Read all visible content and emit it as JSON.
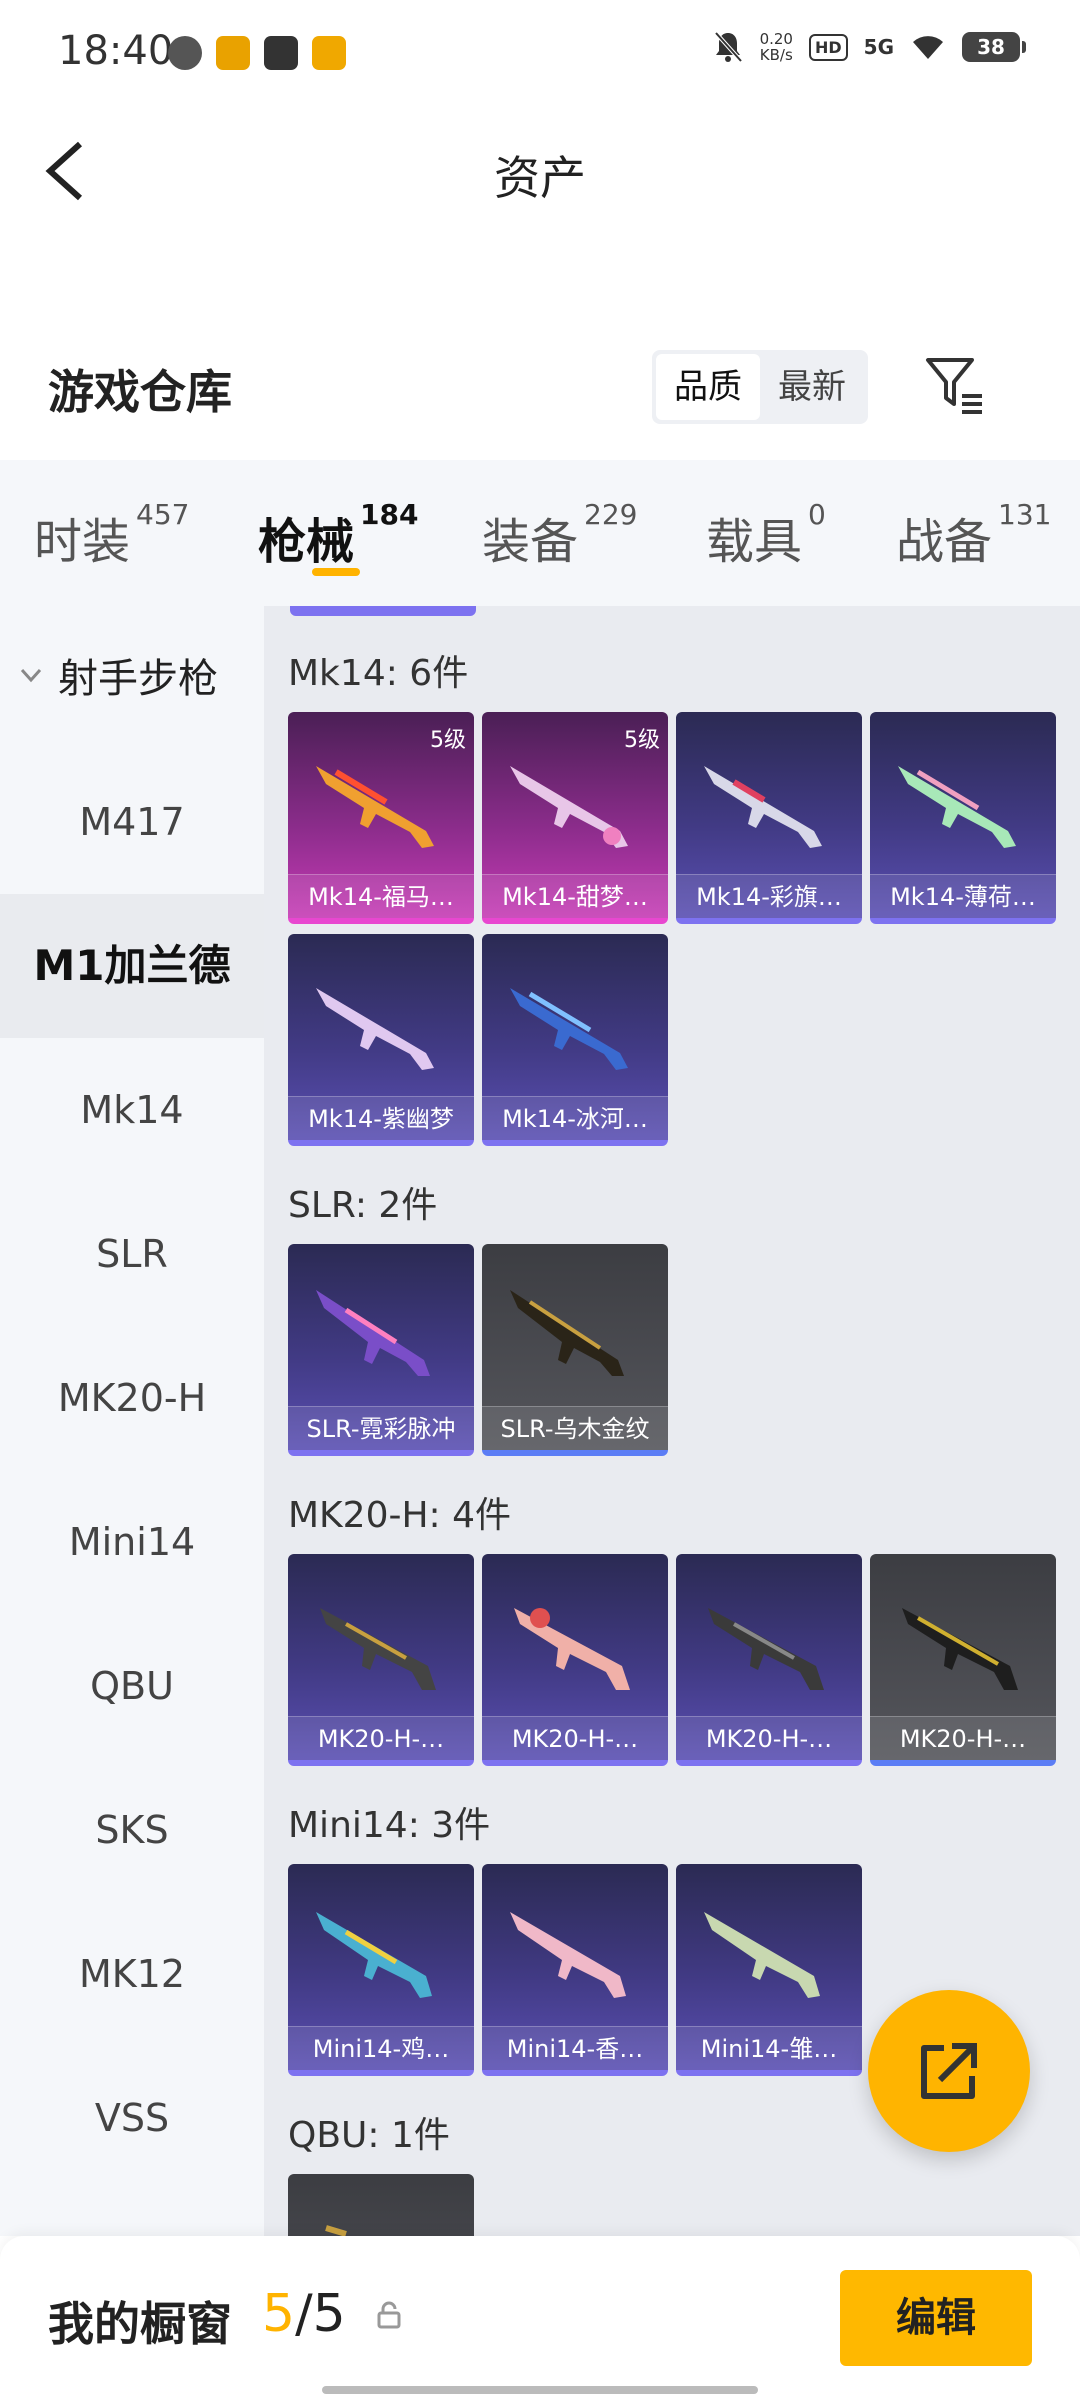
{
  "status": {
    "time": "18:40",
    "net_speed_value": "0.20",
    "net_speed_unit": "KB/s",
    "hd": "HD",
    "signal": "5G",
    "battery": "38"
  },
  "header": {
    "title": "资产"
  },
  "warehouse": {
    "title": "游戏仓库",
    "sort_quality": "品质",
    "sort_newest": "最新"
  },
  "tabs": [
    {
      "label": "时装",
      "count": "457"
    },
    {
      "label": "枪械",
      "count": "184"
    },
    {
      "label": "装备",
      "count": "229"
    },
    {
      "label": "载具",
      "count": "0"
    },
    {
      "label": "战备",
      "count": "131"
    }
  ],
  "sidebar": {
    "group": "射手步枪",
    "items": [
      "M417",
      "M1加兰德",
      "Mk14",
      "SLR",
      "MK20-H",
      "Mini14",
      "QBU",
      "SKS",
      "MK12",
      "VSS"
    ]
  },
  "sections": [
    {
      "title": "Mk14: 6件",
      "items": [
        {
          "label": "Mk14-福马…",
          "level": "5级"
        },
        {
          "label": "Mk14-甜梦…",
          "level": "5级"
        },
        {
          "label": "Mk14-彩旗…",
          "level": ""
        },
        {
          "label": "Mk14-薄荷…",
          "level": ""
        },
        {
          "label": "Mk14-紫幽梦",
          "level": ""
        },
        {
          "label": "Mk14-冰河…",
          "level": ""
        }
      ]
    },
    {
      "title": "SLR: 2件",
      "items": [
        {
          "label": "SLR-霓彩脉冲",
          "level": ""
        },
        {
          "label": "SLR-乌木金纹",
          "level": ""
        }
      ]
    },
    {
      "title": "MK20-H: 4件",
      "items": [
        {
          "label": "MK20-H-…",
          "level": ""
        },
        {
          "label": "MK20-H-…",
          "level": ""
        },
        {
          "label": "MK20-H-…",
          "level": ""
        },
        {
          "label": "MK20-H-…",
          "level": ""
        }
      ]
    },
    {
      "title": "Mini14: 3件",
      "items": [
        {
          "label": "Mini14-鸡…",
          "level": ""
        },
        {
          "label": "Mini14-香…",
          "level": ""
        },
        {
          "label": "Mini14-雏…",
          "level": ""
        }
      ]
    },
    {
      "title": "QBU: 1件",
      "items": []
    }
  ],
  "bottom": {
    "showcase_label": "我的橱窗",
    "current": "5",
    "total": "/5",
    "edit": "编辑"
  },
  "colors": {
    "accent": "#ffb300",
    "purple_rarity": "#7d72f0",
    "pink_rarity": "#e847d0"
  },
  "icons": [
    "back-icon",
    "filter-icon",
    "chevron-down-icon",
    "share-icon",
    "lock-icon"
  ]
}
